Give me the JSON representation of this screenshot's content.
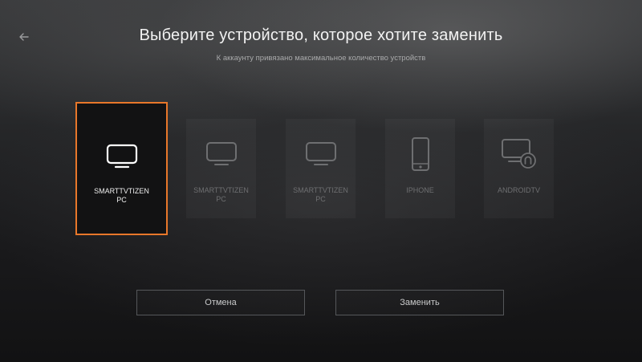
{
  "header": {
    "back_icon": "arrow-left-icon",
    "title": "Выберите устройство, которое хотите заменить",
    "subtitle": "К аккаунту привязано максимальное количество устройств"
  },
  "devices": [
    {
      "label_line1": "SMARTTVTIZEN",
      "label_line2": "PC",
      "icon": "tv-icon",
      "selected": true
    },
    {
      "label_line1": "SMARTTVTIZEN",
      "label_line2": "PC",
      "icon": "tv-icon",
      "selected": false
    },
    {
      "label_line1": "SMARTTVTIZEN",
      "label_line2": "PC",
      "icon": "tv-icon",
      "selected": false
    },
    {
      "label_line1": "IPHONE",
      "label_line2": "",
      "icon": "phone-icon",
      "selected": false
    },
    {
      "label_line1": "ANDROIDTV",
      "label_line2": "",
      "icon": "android-tv-icon",
      "selected": false
    }
  ],
  "actions": {
    "cancel_label": "Отмена",
    "replace_label": "Заменить"
  },
  "colors": {
    "accent": "#e8772a",
    "text_primary": "#f2f2f2",
    "text_dim": "#6e6f71"
  }
}
